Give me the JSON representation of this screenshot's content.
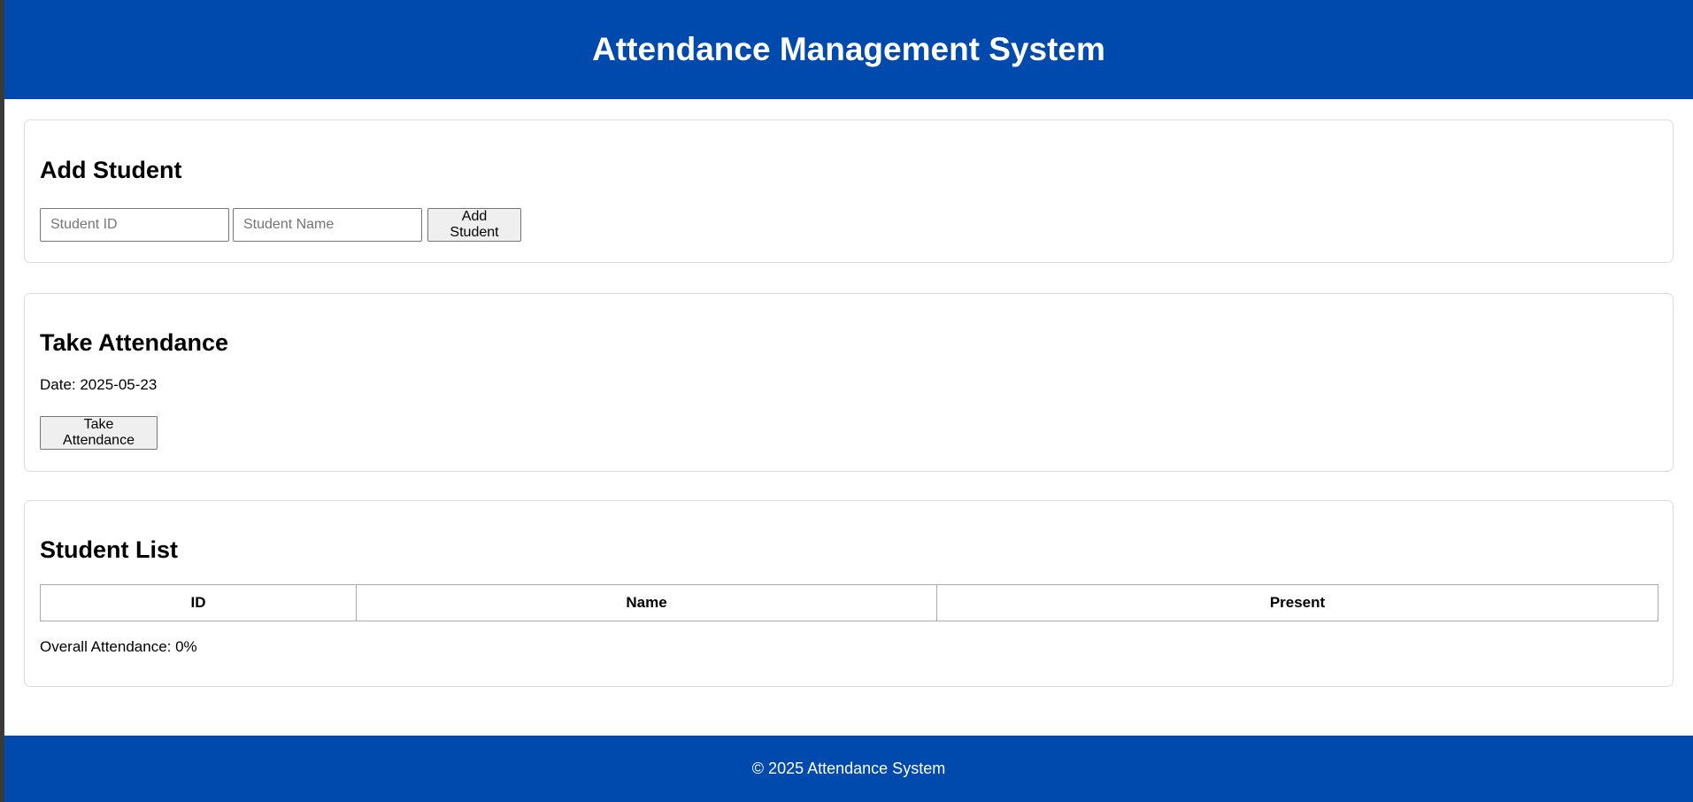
{
  "header": {
    "title": "Attendance Management System"
  },
  "add_student": {
    "heading": "Add Student",
    "id_placeholder": "Student ID",
    "name_placeholder": "Student Name",
    "button": "Add Student"
  },
  "take_attendance": {
    "heading": "Take Attendance",
    "date": "Date: 2025-05-23",
    "button": "Take Attendance"
  },
  "student_list": {
    "heading": "Student List",
    "columns": [
      "ID",
      "Name",
      "Present"
    ],
    "rows": [],
    "overall": "Overall Attendance: 0%"
  },
  "footer": {
    "text": "© 2025 Attendance System"
  },
  "colors": {
    "brand": "#004aad"
  }
}
